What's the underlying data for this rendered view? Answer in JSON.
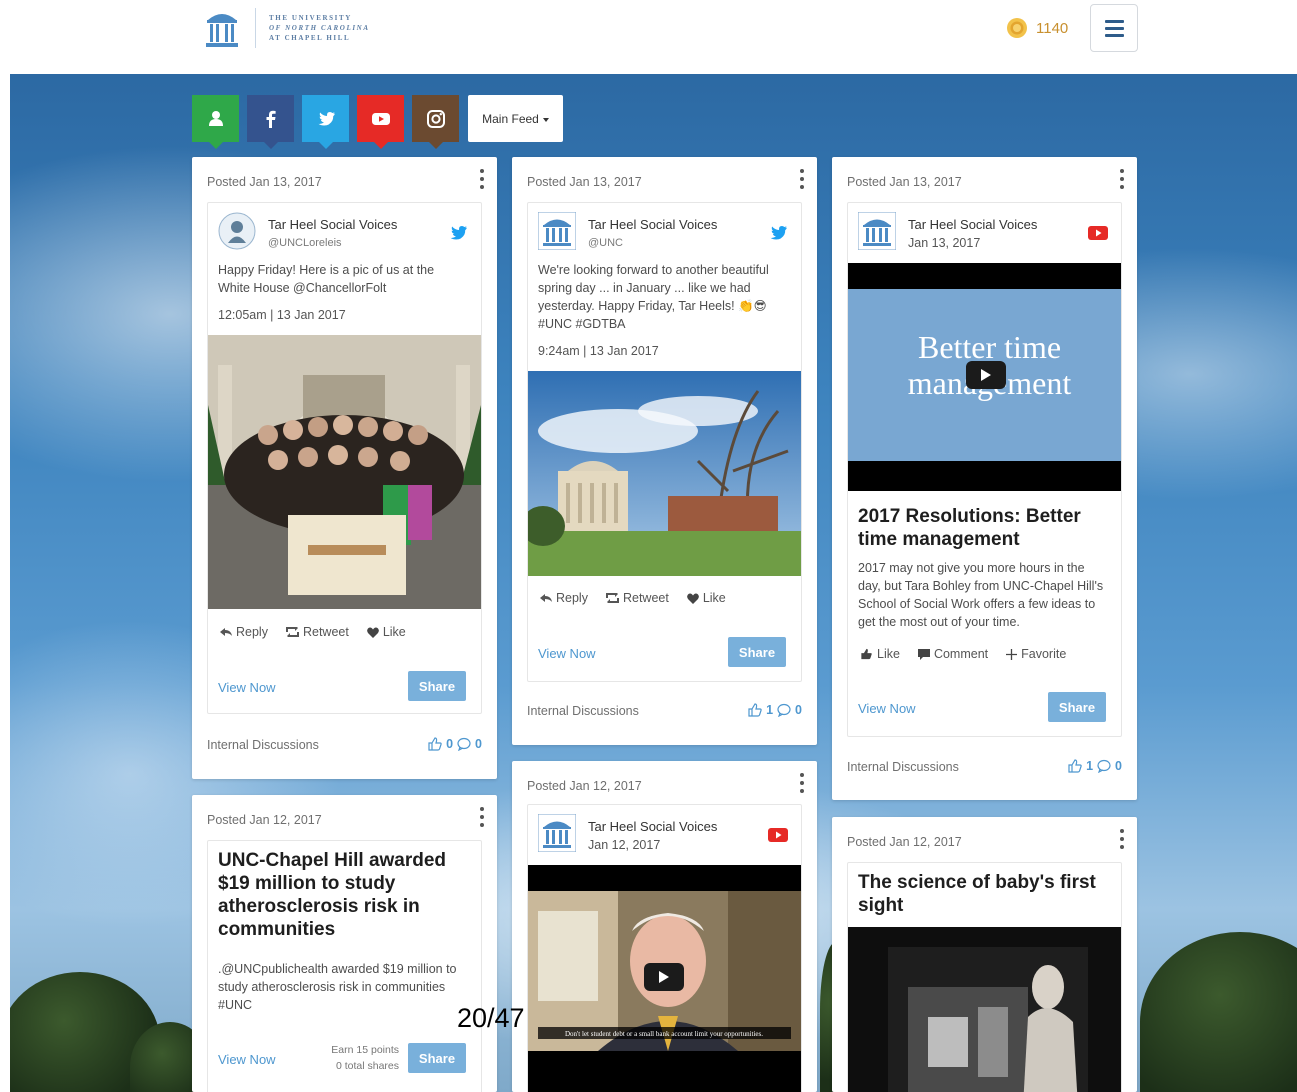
{
  "header": {
    "logo_lines": [
      "The University",
      "of North Carolina",
      "at Chapel Hill"
    ],
    "points": "1140",
    "menu_icon": "hamburger-icon"
  },
  "colors": {
    "accent": "#4e97cf",
    "share_button": "#79b0db",
    "points_gold": "#c8902f",
    "tab_user": "#2fa849",
    "tab_facebook": "#34538e",
    "tab_twitter": "#29a6e3",
    "tab_youtube": "#e62a26",
    "tab_instagram": "#6b4a30"
  },
  "feed_tabs": [
    {
      "name": "user",
      "icon": "user-icon"
    },
    {
      "name": "facebook",
      "icon": "facebook-icon"
    },
    {
      "name": "twitter",
      "icon": "twitter-icon"
    },
    {
      "name": "youtube",
      "icon": "youtube-icon"
    },
    {
      "name": "instagram",
      "icon": "instagram-icon"
    }
  ],
  "feed_select": {
    "label": "Main Feed"
  },
  "cards": [
    {
      "posted": "Posted Jan 13, 2017",
      "author": "Tar Heel Social Voices",
      "handle": "@UNCLoreleis",
      "network": "twitter",
      "text": "Happy Friday! Here is a pic of us at the White House @ChancellorFolt",
      "timestamp": "12:05am | 13 Jan 2017",
      "actions": [
        "Reply",
        "Retweet",
        "Like"
      ],
      "view_now": "View Now",
      "share": "Share",
      "footer": "Internal Discussions",
      "likes": "0",
      "comments": "0"
    },
    {
      "posted": "Posted Jan 13, 2017",
      "author": "Tar Heel Social Voices",
      "handle": "@UNC",
      "network": "twitter",
      "text": "We're looking forward to another beautiful spring day ... in January ... like we had yesterday. Happy Friday, Tar Heels! 👏😎 #UNC #GDTBA",
      "timestamp": "9:24am | 13 Jan 2017",
      "actions": [
        "Reply",
        "Retweet",
        "Like"
      ],
      "view_now": "View Now",
      "share": "Share",
      "footer": "Internal Discussions",
      "likes": "1",
      "comments": "0"
    },
    {
      "posted": "Posted Jan 13, 2017",
      "author": "Tar Heel Social Voices",
      "date": "Jan 13, 2017",
      "network": "youtube",
      "video_title": "Better time management",
      "headline": "2017 Resolutions: Better time management",
      "text": "2017 may not give you more hours in the day, but Tara Bohley from UNC-Chapel Hill's School of Social Work offers a few ideas to get the most out of your time.",
      "actions": [
        "Like",
        "Comment",
        "Favorite"
      ],
      "view_now": "View Now",
      "share": "Share",
      "footer": "Internal Discussions",
      "likes": "1",
      "comments": "0"
    },
    {
      "posted": "Posted Jan 12, 2017",
      "headline": "UNC-Chapel Hill awarded $19 million to study atherosclerosis risk in communities",
      "text": ".@UNCpublichealth awarded $19 million to study atherosclerosis risk in communities #UNC",
      "view_now": "View Now",
      "earn_points": "Earn 15 points",
      "total_shares": "0 total shares",
      "share": "Share"
    },
    {
      "posted": "Posted Jan 12, 2017",
      "author": "Tar Heel Social Voices",
      "date": "Jan 12, 2017",
      "network": "youtube",
      "caption": "Don't let student debt or a small bank account limit your opportunities."
    },
    {
      "posted": "Posted Jan 12, 2017",
      "headline": "The science of baby's first sight"
    }
  ],
  "pager": "20/47"
}
